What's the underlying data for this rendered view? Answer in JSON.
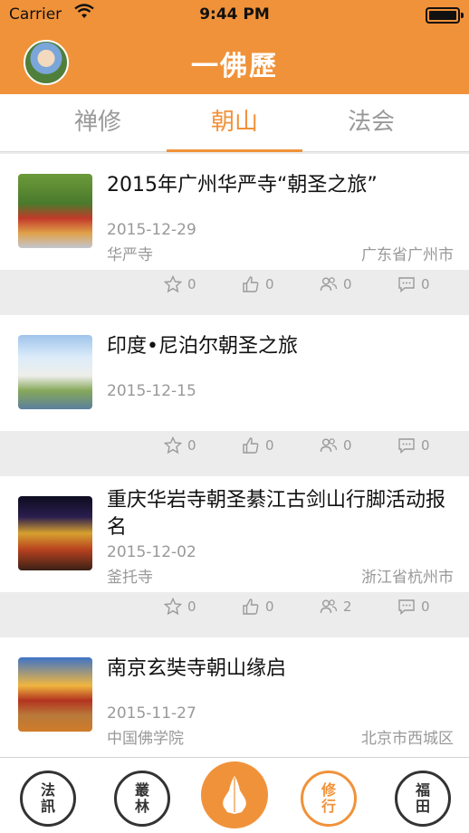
{
  "status": {
    "carrier": "Carrier",
    "time": "9:44 PM"
  },
  "app": {
    "title": "一佛歷"
  },
  "tabs": [
    {
      "label": "禅修"
    },
    {
      "label": "朝山"
    },
    {
      "label": "法会"
    }
  ],
  "active_tab": "朝山",
  "accent_color": "#f0923a",
  "items": [
    {
      "title": "2015年广州华严寺“朝圣之旅”",
      "date": "2015-12-29",
      "place": "华严寺",
      "region": "广东省广州市",
      "stats": {
        "favorites": "0",
        "likes": "0",
        "participants": "0",
        "comments": "0"
      }
    },
    {
      "title": "印度•尼泊尔朝圣之旅",
      "date": "2015-12-15",
      "place": "",
      "region": "",
      "stats": {
        "favorites": "0",
        "likes": "0",
        "participants": "0",
        "comments": "0"
      }
    },
    {
      "title": "重庆华岩寺朝圣綦江古剑山行脚活动报名",
      "date": "2015-12-02",
      "place": "釜托寺",
      "region": "浙江省杭州市",
      "stats": {
        "favorites": "0",
        "likes": "0",
        "participants": "2",
        "comments": "0"
      }
    },
    {
      "title": "南京玄奘寺朝山缘启",
      "date": "2015-11-27",
      "place": "中国佛学院",
      "region": "北京市西城区"
    }
  ],
  "bottom_nav": [
    {
      "label_top": "法",
      "label_bottom": "訊",
      "icon": "fa-xun-seal-icon"
    },
    {
      "label_top": "叢",
      "label_bottom": "林",
      "icon": "cong-lin-seal-icon"
    },
    {
      "label_top": "",
      "label_bottom": "",
      "icon": "praying-hands-icon"
    },
    {
      "label_top": "修",
      "label_bottom": "行",
      "icon": "xiu-xing-seal-icon"
    },
    {
      "label_top": "福",
      "label_bottom": "田",
      "icon": "fu-tian-seal-icon"
    }
  ],
  "bottom_nav_active": "修行"
}
